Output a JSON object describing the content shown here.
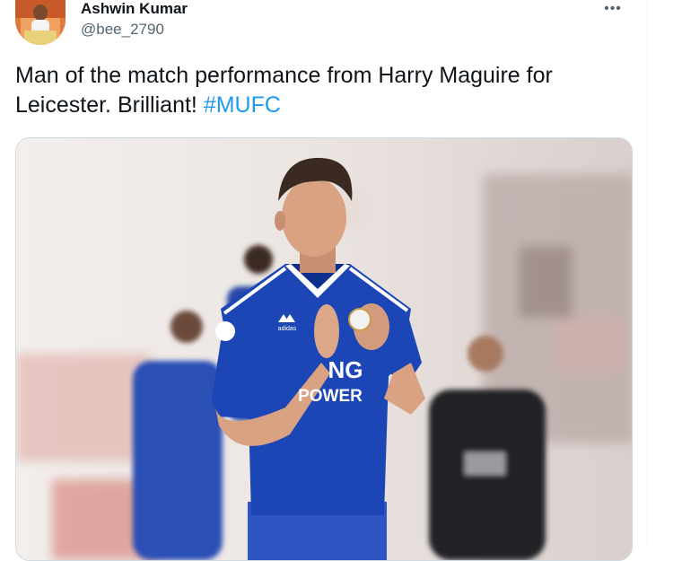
{
  "tweet": {
    "author_name": "Ashwin Kumar",
    "author_handle": "@bee_2790",
    "text": "Man of the match performance from Harry Maguire for Leicester. Brilliant! ",
    "hashtag": "#MUFC",
    "more_icon": "ellipsis-icon"
  },
  "media": {
    "shirt_text_line1": "NG",
    "shirt_text_line2": "POWER",
    "shirt_brand": "adidas",
    "accent_color": "#1d9bf0",
    "kit_color": "#1c45b5"
  }
}
